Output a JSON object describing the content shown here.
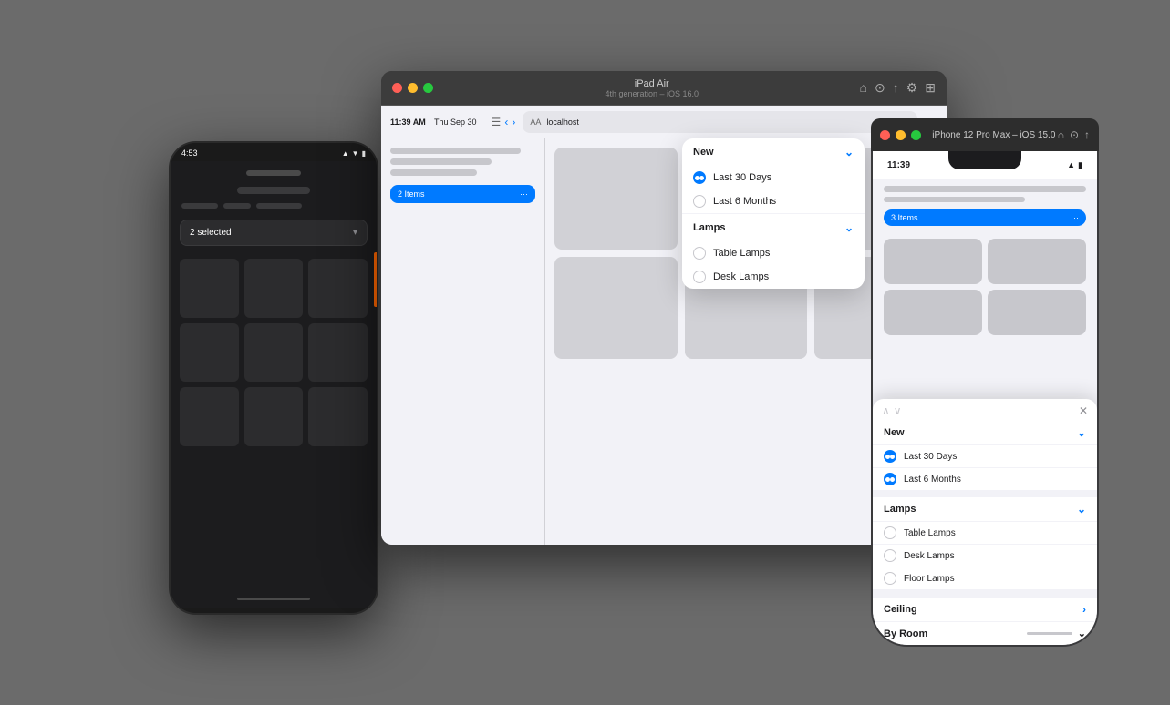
{
  "background": "#6b6b6b",
  "android": {
    "time": "4:53",
    "selected_label": "2 selected",
    "grid_count": 9
  },
  "ipad_window": {
    "title": "iPad Air",
    "subtitle": "4th generation – iOS 16.0",
    "time": "11:39 AM",
    "date": "Thu Sep 30",
    "address": "localhost",
    "section_btn": "2 Items",
    "dropdown": {
      "new_label": "New",
      "items": [
        {
          "label": "Last 30 Days",
          "selected": true
        },
        {
          "label": "Last 6 Months",
          "selected": false
        }
      ],
      "lamps_label": "Lamps",
      "lamps_items": [
        {
          "label": "Table Lamps",
          "selected": false
        },
        {
          "label": "Desk Lamps",
          "selected": false
        }
      ]
    }
  },
  "iphone_window": {
    "title": "iPhone 12 Pro Max – iOS 15.0",
    "time": "11:39",
    "section_btn": "3 Items",
    "popup": {
      "new_label": "New",
      "new_items": [
        {
          "label": "Last 30 Days",
          "selected": true
        },
        {
          "label": "Last 6 Months",
          "selected": true
        }
      ],
      "lamps_label": "Lamps",
      "lamps_items": [
        {
          "label": "Table Lamps",
          "selected": false
        },
        {
          "label": "Desk Lamps",
          "selected": false
        },
        {
          "label": "Floor Lamps",
          "selected": false
        }
      ],
      "ceiling_label": "Ceiling",
      "by_room_label": "By Room"
    }
  }
}
